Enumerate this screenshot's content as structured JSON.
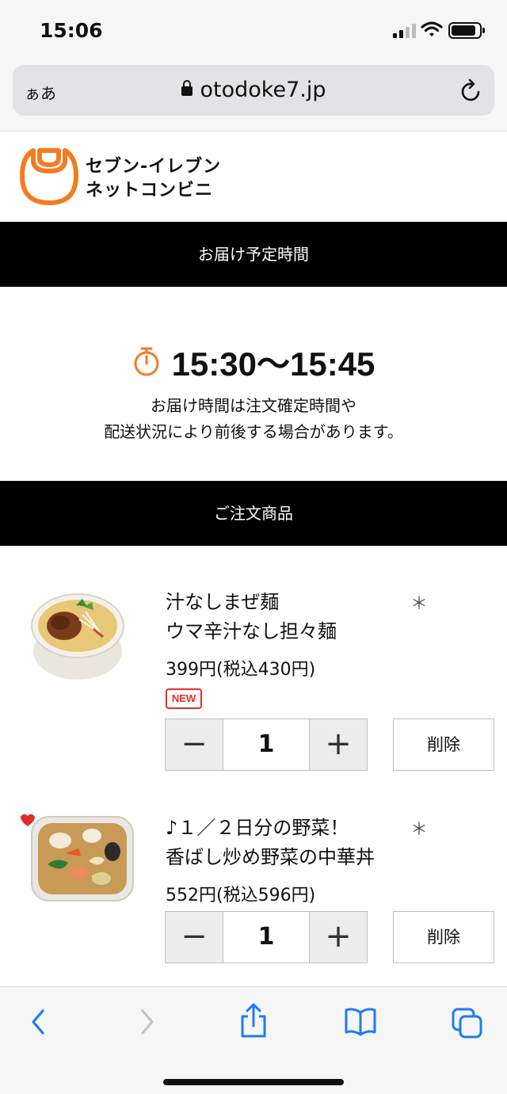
{
  "status_bar": {
    "time": "15:06"
  },
  "browser": {
    "aa_label": "ぁあ",
    "url": "otodoke7.jp"
  },
  "brand": {
    "line1": "セブン-イレブン",
    "line2": "ネットコンビニ",
    "color": "#f47b20"
  },
  "delivery": {
    "section_title": "お届け予定時間",
    "time_range": "15:30〜15:45",
    "note_line1": "お届け時間は注文確定時間や",
    "note_line2": "配送状況により前後する場合があります。"
  },
  "order": {
    "section_title": "ご注文商品",
    "items": [
      {
        "name_line1": "汁なしまぜ麺",
        "name_line2": "ウマ辛汁なし担々麺",
        "price": "399円(税込430円)",
        "badge": "NEW",
        "quantity": "1",
        "delete_label": "削除",
        "asterisk": "＊"
      },
      {
        "name_line1": "♪１／２日分の野菜！",
        "name_line2": "香ばし炒め野菜の中華丼",
        "price": "552円(税込596円)",
        "quantity": "1",
        "delete_label": "削除",
        "asterisk": "＊"
      }
    ]
  },
  "stepper": {
    "minus": "−",
    "plus": "+"
  },
  "icons": {
    "back": "chevron-left-icon",
    "forward": "chevron-right-icon",
    "share": "share-icon",
    "bookmarks": "book-icon",
    "tabs": "tabs-icon"
  },
  "colors": {
    "accent": "#f47b20",
    "ios_blue": "#1a7cf5",
    "badge_red": "#e62b2b"
  }
}
